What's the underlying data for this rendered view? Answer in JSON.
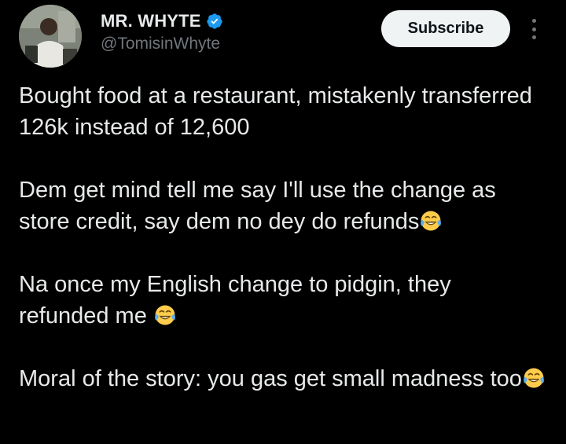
{
  "author": {
    "display_name": "MR. WHYTE",
    "handle": "@TomisinWhyte",
    "verified": true
  },
  "actions": {
    "subscribe_label": "Subscribe",
    "more_icon": "more-vertical-icon"
  },
  "tweet": {
    "paragraphs": [
      {
        "text": "Bought food at a restaurant, mistakenly transferred 126k instead of 12,600",
        "emoji": ""
      },
      {
        "text": "Dem get mind tell me say I'll use the change as store credit, say dem no dey do refunds",
        "emoji": "face-with-tears-of-joy"
      },
      {
        "text": "Na once my English change to pidgin, they refunded me ",
        "emoji": "face-with-tears-of-joy"
      },
      {
        "text": "Moral of the story: you gas get small madness too",
        "emoji": "face-with-tears-of-joy"
      }
    ]
  },
  "colors": {
    "background": "#000000",
    "primary_text": "#e7e9ea",
    "secondary_text": "#71767b",
    "verified_blue": "#1d9bf0",
    "button_bg": "#eff3f4"
  }
}
